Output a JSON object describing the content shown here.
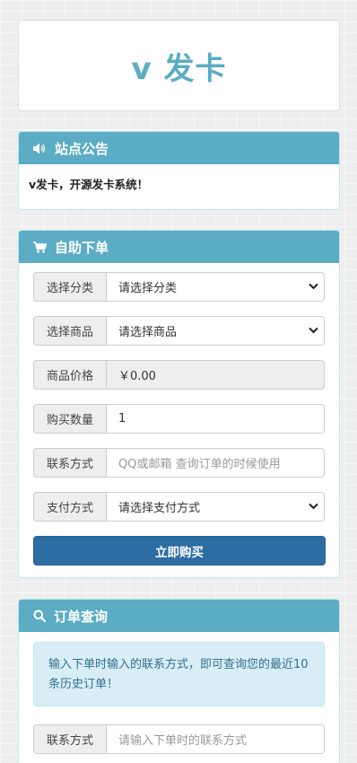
{
  "brand": {
    "title": "v 发卡"
  },
  "notice": {
    "heading": "站点公告",
    "text": "v发卡，开源发卡系统！"
  },
  "order": {
    "heading": "自助下单",
    "category_label": "选择分类",
    "category_value": "请选择分类",
    "product_label": "选择商品",
    "product_value": "请选择商品",
    "price_label": "商品价格",
    "price_value": "￥0.00",
    "quantity_label": "购买数量",
    "quantity_value": "1",
    "contact_label": "联系方式",
    "contact_placeholder": "QQ或邮箱 查询订单的时候使用",
    "payment_label": "支付方式",
    "payment_value": "请选择支付方式",
    "buy_label": "立即购买"
  },
  "query": {
    "heading": "订单查询",
    "info": "输入下单时输入的联系方式，即可查询您的最近10条历史订单！",
    "contact_label": "联系方式",
    "contact_placeholder": "请输入下单时的联系方式"
  },
  "icons": {
    "notice": "volume-icon",
    "order": "cart-icon",
    "query": "search-icon",
    "select": "chevron-down-icon"
  },
  "colors": {
    "heading_bg": "#5bacc4",
    "brand_text": "#5bacc4",
    "primary_button": "#2e6da4",
    "info_bg": "#d9edf7",
    "info_text": "#31708f"
  }
}
